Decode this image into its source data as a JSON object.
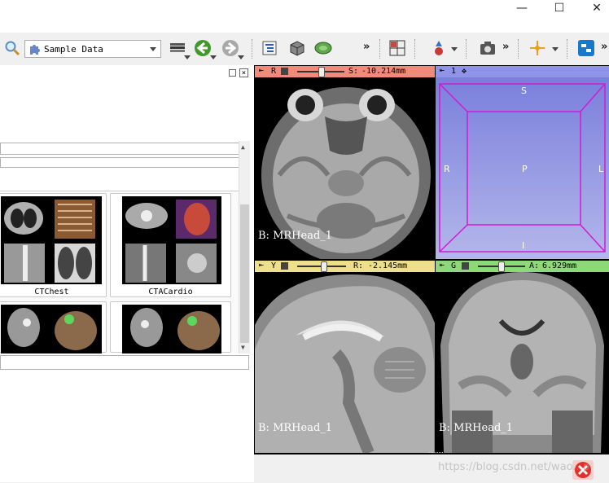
{
  "window": {
    "minimize_glyph": "—",
    "maximize_glyph": "☐",
    "close_glyph": "✕"
  },
  "toolbar": {
    "module_selector": "Sample Data",
    "more_glyph": "»"
  },
  "sample_data": {
    "items": [
      {
        "label": "CTChest"
      },
      {
        "label": "CTACardio"
      }
    ]
  },
  "views": {
    "red": {
      "slice": "R",
      "orientation": "S:",
      "offset": "-10.214mm",
      "volume_label": "B: MRHead_1",
      "color": "#f08a7a"
    },
    "threed": {
      "slice": "1",
      "orientation_labels": {
        "top": "S",
        "left": "R",
        "right": "L",
        "center": "P",
        "bottom": "I"
      },
      "color": "#8f94e8"
    },
    "yellow": {
      "slice": "Y",
      "orientation": "R:",
      "offset": "-2.145mm",
      "volume_label": "B: MRHead_1",
      "color": "#eee08a"
    },
    "green": {
      "slice": "G",
      "orientation": "A:",
      "offset": "6.929mm",
      "volume_label": "B: MRHead_1",
      "color": "#8fd87a"
    }
  },
  "watermark": "https://blog.csdn.net/wao...p"
}
